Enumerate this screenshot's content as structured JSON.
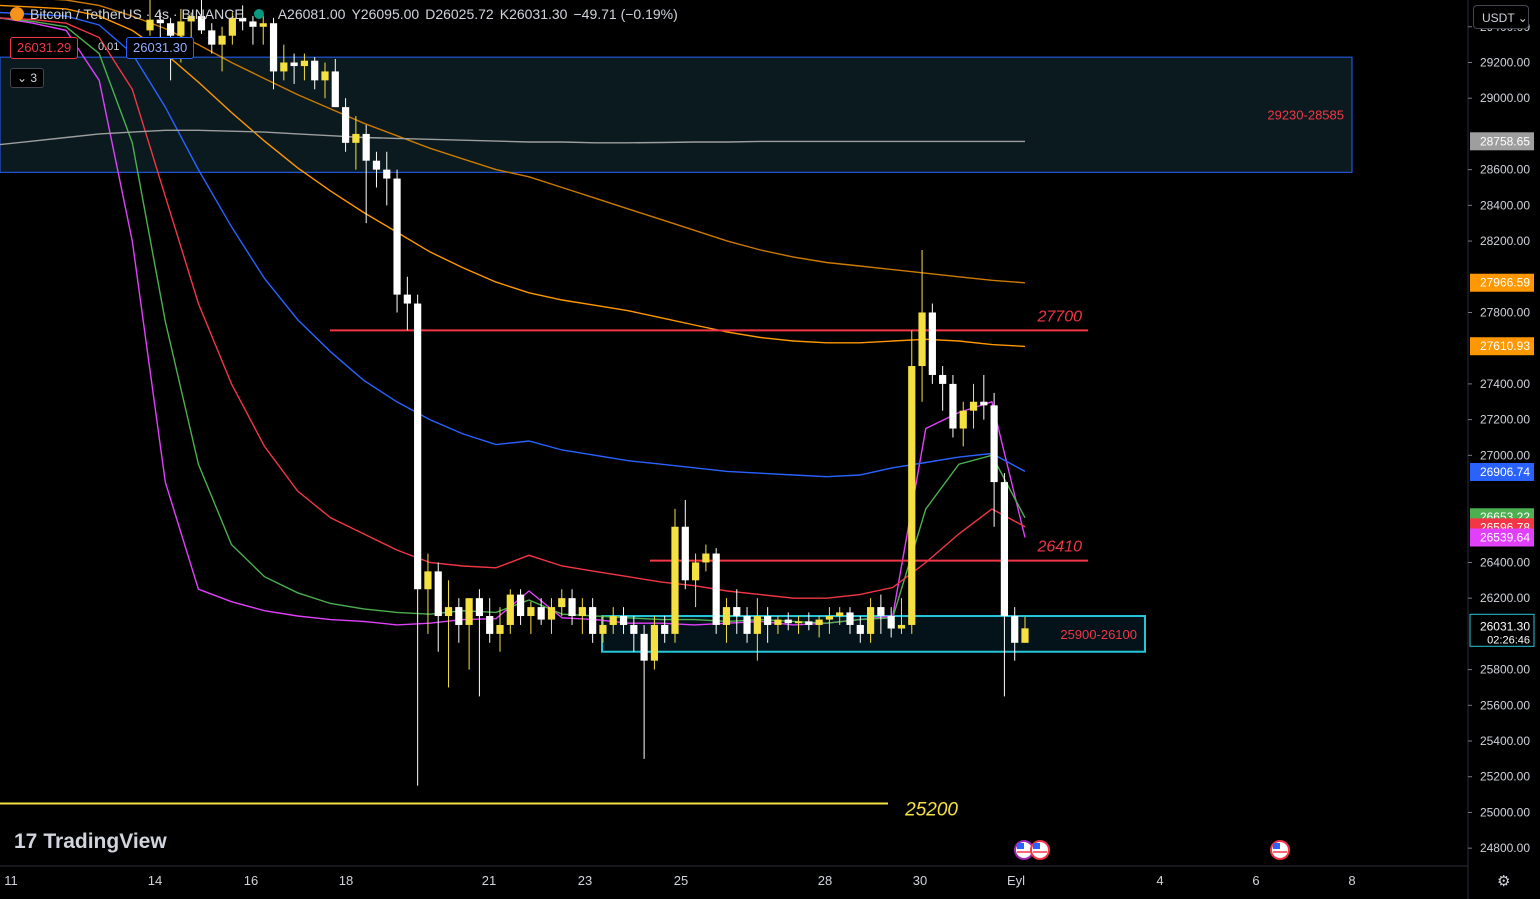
{
  "header": {
    "symbol_title": "Bitcoin / TetherUS · 4s · BINANCE",
    "open_label": "A",
    "open": "26081.00",
    "high_label": "Y",
    "high": "26095.00",
    "low_label": "D",
    "low": "26025.72",
    "close_label": "K",
    "close": "26031.30",
    "change": "−49.71 (−0.19%)"
  },
  "trade": {
    "sell": "26031.29",
    "spread": "0.01",
    "buy": "26031.30"
  },
  "indicator_count": "3",
  "currency": "USDT",
  "logo_text": "TradingView",
  "colors": {
    "up": "#f5e042",
    "down": "#ffffff",
    "ema_magenta": "#e040fb",
    "ema_green": "#4caf50",
    "ema_red": "#f23645",
    "ema_blue": "#2962ff",
    "ema_orange": "#ff9800",
    "ema_gray": "#9e9e9e",
    "zone_blue": "#2962ff",
    "zone_cyan": "#26c6da",
    "level_red": "#f23645",
    "level_yellow": "#f5e042"
  },
  "chart_data": {
    "type": "candlestick",
    "ylim": [
      24700,
      29550
    ],
    "x_ticks": [
      "11",
      "14",
      "16",
      "18",
      "21",
      "23",
      "25",
      "28",
      "30",
      "Eyl",
      "4",
      "6",
      "8"
    ],
    "y_ticks": [
      "29400.00",
      "29200.00",
      "29000.00",
      "28600.00",
      "28400.00",
      "28200.00",
      "27800.00",
      "27400.00",
      "27200.00",
      "27000.00",
      "26400.00",
      "26200.00",
      "25800.00",
      "25600.00",
      "25400.00",
      "25200.00",
      "25000.00",
      "24800.00"
    ],
    "price_tags": [
      {
        "text": "28758.65",
        "value": 28758.65,
        "color": "#9e9e9e"
      },
      {
        "text": "27966.59",
        "value": 27966.59,
        "color": "#ff9800"
      },
      {
        "text": "27610.93",
        "value": 27610.93,
        "color": "#ff9800"
      },
      {
        "text": "26906.74",
        "value": 26906.74,
        "color": "#2962ff"
      },
      {
        "text": "26653.22",
        "value": 26653.22,
        "color": "#4caf50"
      },
      {
        "text": "26596.78",
        "value": 26596.78,
        "color": "#f23645"
      },
      {
        "text": "26539.64",
        "value": 26539.64,
        "color": "#e040fb"
      }
    ],
    "last_price": {
      "text": "26031.30",
      "countdown": "02:26:46",
      "value": 26031.3
    },
    "zones": [
      {
        "label": "29230-28585",
        "low": 28585,
        "high": 29230,
        "color": "#2962ff"
      },
      {
        "label": "25900-26100",
        "low": 25900,
        "high": 26100,
        "color": "#26c6da"
      }
    ],
    "levels": [
      {
        "label": "27700",
        "value": 27700,
        "color": "#f23645"
      },
      {
        "label": "26410",
        "value": 26410,
        "color": "#f23645"
      },
      {
        "label": "25200",
        "value": 25050,
        "color": "#f5e042"
      }
    ],
    "ema": [
      {
        "color": "#e040fb",
        "values": [
          29450,
          29420,
          29380,
          29100,
          28200,
          26850,
          26250,
          26180,
          26130,
          26100,
          26080,
          26070,
          26050,
          26060,
          26080,
          26085,
          26240,
          26090,
          26080,
          26060,
          26060,
          26050,
          26060,
          26070,
          26050,
          26060,
          26080,
          26100,
          27150,
          27240,
          27300,
          26540
        ]
      },
      {
        "color": "#4caf50",
        "values": [
          29450,
          29430,
          29400,
          29250,
          28750,
          27750,
          26950,
          26500,
          26320,
          26230,
          26170,
          26140,
          26120,
          26110,
          26130,
          26120,
          26190,
          26110,
          26100,
          26090,
          26080,
          26080,
          26070,
          26080,
          26070,
          26060,
          26080,
          26090,
          26700,
          26950,
          27000,
          26650
        ]
      },
      {
        "color": "#f23645",
        "values": [
          29450,
          29440,
          29420,
          29340,
          29050,
          28450,
          27850,
          27400,
          27050,
          26800,
          26650,
          26560,
          26470,
          26400,
          26380,
          26370,
          26440,
          26380,
          26350,
          26320,
          26290,
          26270,
          26240,
          26220,
          26200,
          26200,
          26220,
          26260,
          26400,
          26560,
          26700,
          26600
        ]
      },
      {
        "color": "#2962ff",
        "values": [
          29480,
          29470,
          29460,
          29410,
          29250,
          28950,
          28600,
          28280,
          27990,
          27760,
          27580,
          27420,
          27300,
          27200,
          27120,
          27060,
          27080,
          27030,
          27000,
          26970,
          26950,
          26930,
          26910,
          26900,
          26890,
          26880,
          26890,
          26930,
          26960,
          26990,
          27010,
          26910
        ]
      },
      {
        "color": "#ff9800",
        "values": [
          29520,
          29510,
          29500,
          29460,
          29380,
          29250,
          29090,
          28920,
          28760,
          28610,
          28480,
          28360,
          28250,
          28140,
          28050,
          27970,
          27910,
          27870,
          27840,
          27810,
          27770,
          27730,
          27690,
          27660,
          27640,
          27630,
          27630,
          27640,
          27650,
          27640,
          27620,
          27610
        ]
      },
      {
        "color": "#cc7a00",
        "values": [
          29560,
          29560,
          29550,
          29520,
          29460,
          29390,
          29300,
          29200,
          29110,
          29020,
          28940,
          28860,
          28790,
          28720,
          28660,
          28600,
          28560,
          28500,
          28440,
          28380,
          28320,
          28260,
          28200,
          28150,
          28110,
          28080,
          28060,
          28040,
          28020,
          28000,
          27980,
          27966
        ]
      },
      {
        "color": "#9e9e9e",
        "values": [
          28740,
          28760,
          28780,
          28800,
          28810,
          28820,
          28820,
          28815,
          28810,
          28800,
          28790,
          28780,
          28775,
          28770,
          28765,
          28760,
          28755,
          28755,
          28750,
          28750,
          28752,
          28755,
          28755,
          28758,
          28758,
          28758,
          28758,
          28758,
          28758,
          28758,
          28758,
          28758
        ]
      }
    ],
    "candles": [
      [
        29380,
        29560,
        29350,
        29440
      ],
      [
        29440,
        29480,
        29300,
        29420
      ],
      [
        29420,
        29450,
        29100,
        29350
      ],
      [
        29350,
        29500,
        29200,
        29430
      ],
      [
        29430,
        29480,
        29340,
        29460
      ],
      [
        29460,
        29560,
        29360,
        29380
      ],
      [
        29380,
        29420,
        29250,
        29300
      ],
      [
        29300,
        29400,
        29150,
        29350
      ],
      [
        29350,
        29480,
        29300,
        29450
      ],
      [
        29450,
        29520,
        29380,
        29430
      ],
      [
        29430,
        29460,
        29300,
        29400
      ],
      [
        29400,
        29460,
        29300,
        29420
      ],
      [
        29420,
        29450,
        29050,
        29150
      ],
      [
        29150,
        29300,
        29100,
        29200
      ],
      [
        29200,
        29250,
        29080,
        29180
      ],
      [
        29180,
        29250,
        29100,
        29210
      ],
      [
        29210,
        29230,
        29050,
        29100
      ],
      [
        29100,
        29200,
        29000,
        29150
      ],
      [
        29150,
        29220,
        28950,
        28950
      ],
      [
        28950,
        29000,
        28700,
        28750
      ],
      [
        28750,
        28900,
        28600,
        28800
      ],
      [
        28800,
        28850,
        28300,
        28650
      ],
      [
        28650,
        28700,
        28500,
        28600
      ],
      [
        28600,
        28700,
        28400,
        28550
      ],
      [
        28550,
        28600,
        27800,
        27900
      ],
      [
        27900,
        28000,
        27700,
        27850
      ],
      [
        27850,
        27900,
        25150,
        26250
      ],
      [
        26250,
        26450,
        26000,
        26350
      ],
      [
        26350,
        26400,
        25900,
        26100
      ],
      [
        26100,
        26300,
        25700,
        26150
      ],
      [
        26150,
        26200,
        25950,
        26050
      ],
      [
        26050,
        26150,
        25800,
        26200
      ],
      [
        26200,
        26250,
        25650,
        26100
      ],
      [
        26100,
        26200,
        25950,
        26000
      ],
      [
        26000,
        26150,
        25900,
        26050
      ],
      [
        26050,
        26250,
        26000,
        26220
      ],
      [
        26220,
        26250,
        26050,
        26100
      ],
      [
        26100,
        26180,
        26000,
        26150
      ],
      [
        26150,
        26200,
        26050,
        26080
      ],
      [
        26080,
        26200,
        26000,
        26150
      ],
      [
        26150,
        26250,
        26100,
        26200
      ],
      [
        26200,
        26250,
        26050,
        26100
      ],
      [
        26100,
        26200,
        26000,
        26150
      ],
      [
        26150,
        26200,
        25950,
        26000
      ],
      [
        26000,
        26100,
        25950,
        26050
      ],
      [
        26050,
        26150,
        26000,
        26100
      ],
      [
        26100,
        26150,
        26000,
        26050
      ],
      [
        26050,
        26100,
        25900,
        26000
      ],
      [
        26000,
        26050,
        25300,
        25850
      ],
      [
        25850,
        26100,
        25800,
        26050
      ],
      [
        26050,
        26100,
        25950,
        26000
      ],
      [
        26000,
        26700,
        25950,
        26600
      ],
      [
        26600,
        26750,
        26250,
        26300
      ],
      [
        26300,
        26450,
        26150,
        26400
      ],
      [
        26400,
        26500,
        26350,
        26450
      ],
      [
        26450,
        26480,
        26000,
        26050
      ],
      [
        26050,
        26200,
        25950,
        26150
      ],
      [
        26150,
        26250,
        26000,
        26100
      ],
      [
        26100,
        26150,
        25950,
        26000
      ],
      [
        26000,
        26200,
        25850,
        26100
      ],
      [
        26100,
        26150,
        25950,
        26050
      ],
      [
        26050,
        26100,
        26000,
        26080
      ],
      [
        26080,
        26120,
        26020,
        26060
      ],
      [
        26060,
        26100,
        26000,
        26070
      ],
      [
        26070,
        26120,
        26020,
        26050
      ],
      [
        26050,
        26100,
        25980,
        26080
      ],
      [
        26080,
        26150,
        26000,
        26100
      ],
      [
        26100,
        26150,
        26050,
        26120
      ],
      [
        26120,
        26150,
        26000,
        26050
      ],
      [
        26050,
        26100,
        25950,
        26000
      ],
      [
        26000,
        26200,
        25950,
        26150
      ],
      [
        26150,
        26220,
        26000,
        26100
      ],
      [
        26100,
        26150,
        25980,
        26030
      ],
      [
        26030,
        26200,
        26000,
        26050
      ],
      [
        26050,
        27700,
        26000,
        27500
      ],
      [
        27500,
        28150,
        27300,
        27800
      ],
      [
        27800,
        27850,
        27400,
        27450
      ],
      [
        27450,
        27500,
        27250,
        27400
      ],
      [
        27400,
        27450,
        27100,
        27150
      ],
      [
        27150,
        27300,
        27050,
        27250
      ],
      [
        27250,
        27400,
        27150,
        27300
      ],
      [
        27300,
        27450,
        27200,
        27280
      ],
      [
        27280,
        27350,
        26600,
        26850
      ],
      [
        26850,
        26900,
        25650,
        26100
      ],
      [
        26100,
        26150,
        25850,
        25950
      ],
      [
        25950,
        26095,
        25950,
        26031
      ]
    ]
  }
}
